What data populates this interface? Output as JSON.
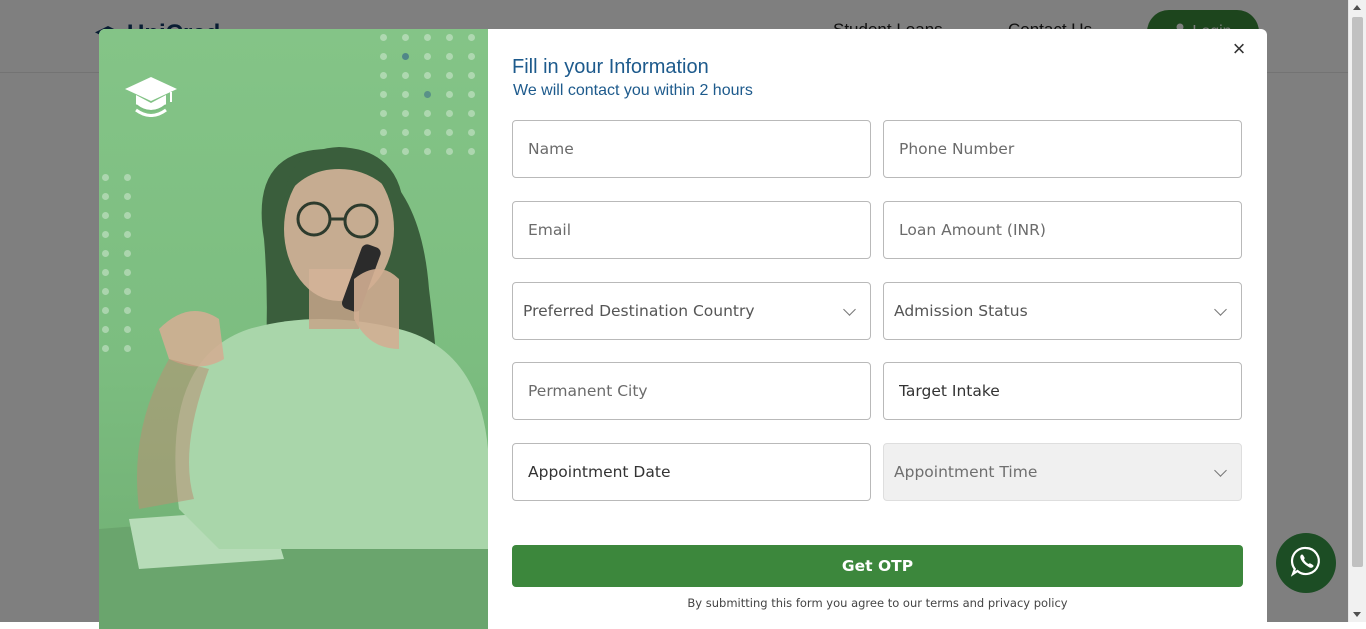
{
  "background": {
    "logo_text": "UniCred",
    "nav": [
      "Student Loans",
      "Contact Us"
    ],
    "login_label": "Login"
  },
  "modal": {
    "close_symbol": "×",
    "title": "Fill in your Information",
    "subtitle": "We will contact you within 2 hours",
    "fields": {
      "name_placeholder": "Name",
      "phone_placeholder": "Phone Number",
      "email_placeholder": "Email",
      "loan_placeholder": "Loan Amount (INR)",
      "destination_label": "Preferred Destination Country",
      "admission_label": "Admission Status",
      "city_placeholder": "Permanent City",
      "intake_value": "Target Intake",
      "appointment_date_value": "Appointment Date",
      "appointment_time_label": "Appointment Time"
    },
    "submit_label": "Get OTP",
    "disclaimer": "By submitting this form you agree to our terms and privacy policy"
  },
  "icons": [
    "graduation-cap-icon",
    "whatsapp-icon",
    "close-icon",
    "chevron-down-icon",
    "user-icon"
  ],
  "colors": {
    "primary_green": "#3c873c",
    "title_blue": "#1d5a8c",
    "whatsapp_bg": "#1c4d24"
  }
}
